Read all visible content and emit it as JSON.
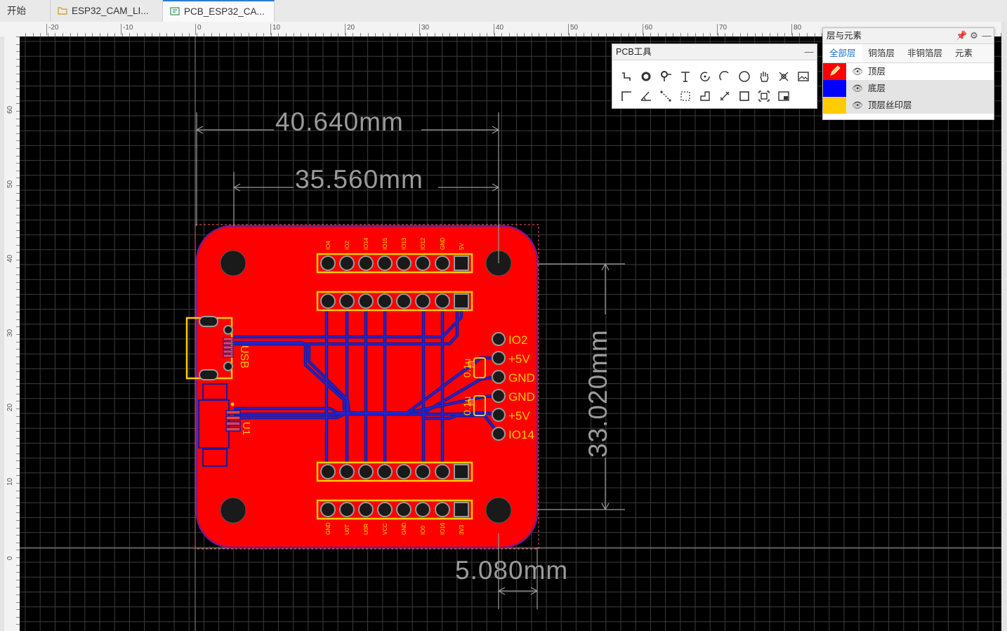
{
  "tabs": [
    {
      "label": "开始"
    },
    {
      "label": "ESP32_CAM_LI..."
    },
    {
      "label": "PCB_ESP32_CA..."
    }
  ],
  "ruler": {
    "top_labels": [
      "-20",
      "-10",
      "0",
      "10",
      "20",
      "30",
      "40",
      "50",
      "60",
      "70",
      "80"
    ],
    "left_labels": [
      "60",
      "50",
      "40",
      "30",
      "20",
      "10",
      "0"
    ]
  },
  "pcb_tools": {
    "title": "PCB工具",
    "minimize": "—",
    "row1": [
      "route-tool-icon",
      "via-tool-icon",
      "pad-tool-icon",
      "text-tool-icon",
      "arc-tool-icon",
      "arc-center-tool-icon",
      "circle-tool-icon",
      "hand-tool-icon",
      "move-tool-icon",
      "image-tool-icon"
    ],
    "row2": [
      "line-tool-icon",
      "angle-tool-icon",
      "dimension-tool-icon",
      "rect-select-tool-icon",
      "polygon-tool-icon",
      "measure-tool-icon",
      "rectangle-tool-icon",
      "region-tool-icon",
      "canvas-tool-icon"
    ]
  },
  "layers_panel": {
    "title": "层与元素",
    "tabs": [
      "全部层",
      "铜箔层",
      "非铜箔层",
      "元素"
    ],
    "active_tab": 0,
    "layers": [
      {
        "name": "顶层",
        "color": "#ff0000"
      },
      {
        "name": "底层",
        "color": "#0000ff"
      },
      {
        "name": "顶层丝印层",
        "color": "#ffcc00"
      }
    ]
  },
  "board": {
    "dimensions": [
      "40.640mm",
      "35.560mm",
      "33.020mm",
      "5.080mm"
    ],
    "top_header_labels": [
      "IO4",
      "IO2",
      "IO14",
      "IO15",
      "IO13",
      "IO12",
      "GND",
      "5V"
    ],
    "bottom_header_labels": [
      "GND",
      "U0T",
      "U0R",
      "VCC",
      "GND",
      "IO0",
      "IO16",
      "3V3"
    ],
    "side_pins": [
      "IO2",
      "+5V",
      "GND",
      "GND",
      "+5V",
      "IO14"
    ],
    "cap_labels": [
      "0.1u",
      "0.1u"
    ],
    "usb_label": "USB",
    "u1_label": "U1"
  }
}
